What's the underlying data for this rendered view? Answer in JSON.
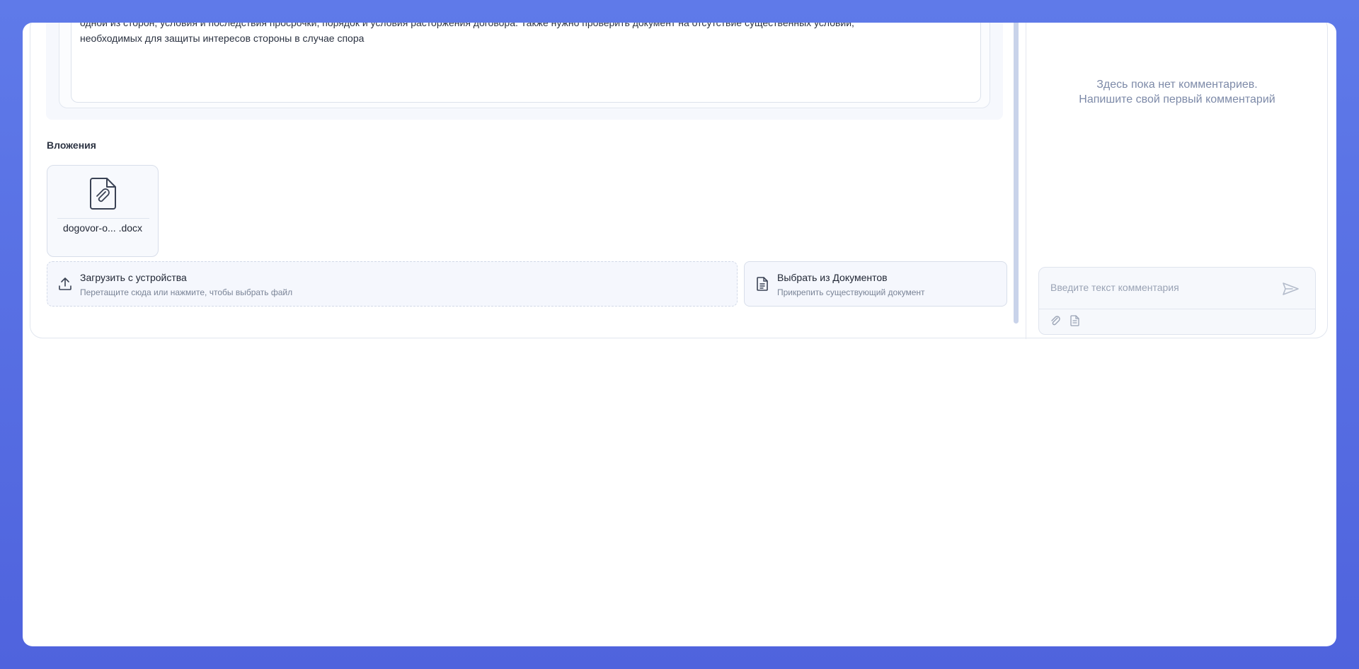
{
  "task": {
    "description_lines": [
      "одной из сторон, условия и последствия просрочки, порядок и условия расторжения договора. Также нужно проверить документ на отсутствие существенных условий,",
      "необходимых для защиты интересов стороны в случае спора"
    ]
  },
  "attachments": {
    "title": "Вложения",
    "files": [
      {
        "name": "dogovor-o... .docx",
        "icon": "paperclip-file-icon"
      }
    ],
    "upload": {
      "title": "Загрузить с устройства",
      "subtitle": "Перетащите сюда или нажмите, чтобы выбрать файл",
      "icon": "upload-icon"
    },
    "documents": {
      "title": "Выбрать из Документов",
      "subtitle": "Прикрепить существующий документ",
      "icon": "document-icon"
    }
  },
  "comments": {
    "empty_line1": "Здесь пока нет комментариев.",
    "empty_line2": "Напишите свой первый комментарий",
    "input_placeholder": "Введите текст комментария",
    "send_icon": "send-icon",
    "attach_icon": "paperclip-icon",
    "doc_icon": "document-icon"
  },
  "colors": {
    "background": "#5a72e6",
    "accent_text": "#7d8aa8",
    "scrollbar": "#c9d3ea"
  }
}
